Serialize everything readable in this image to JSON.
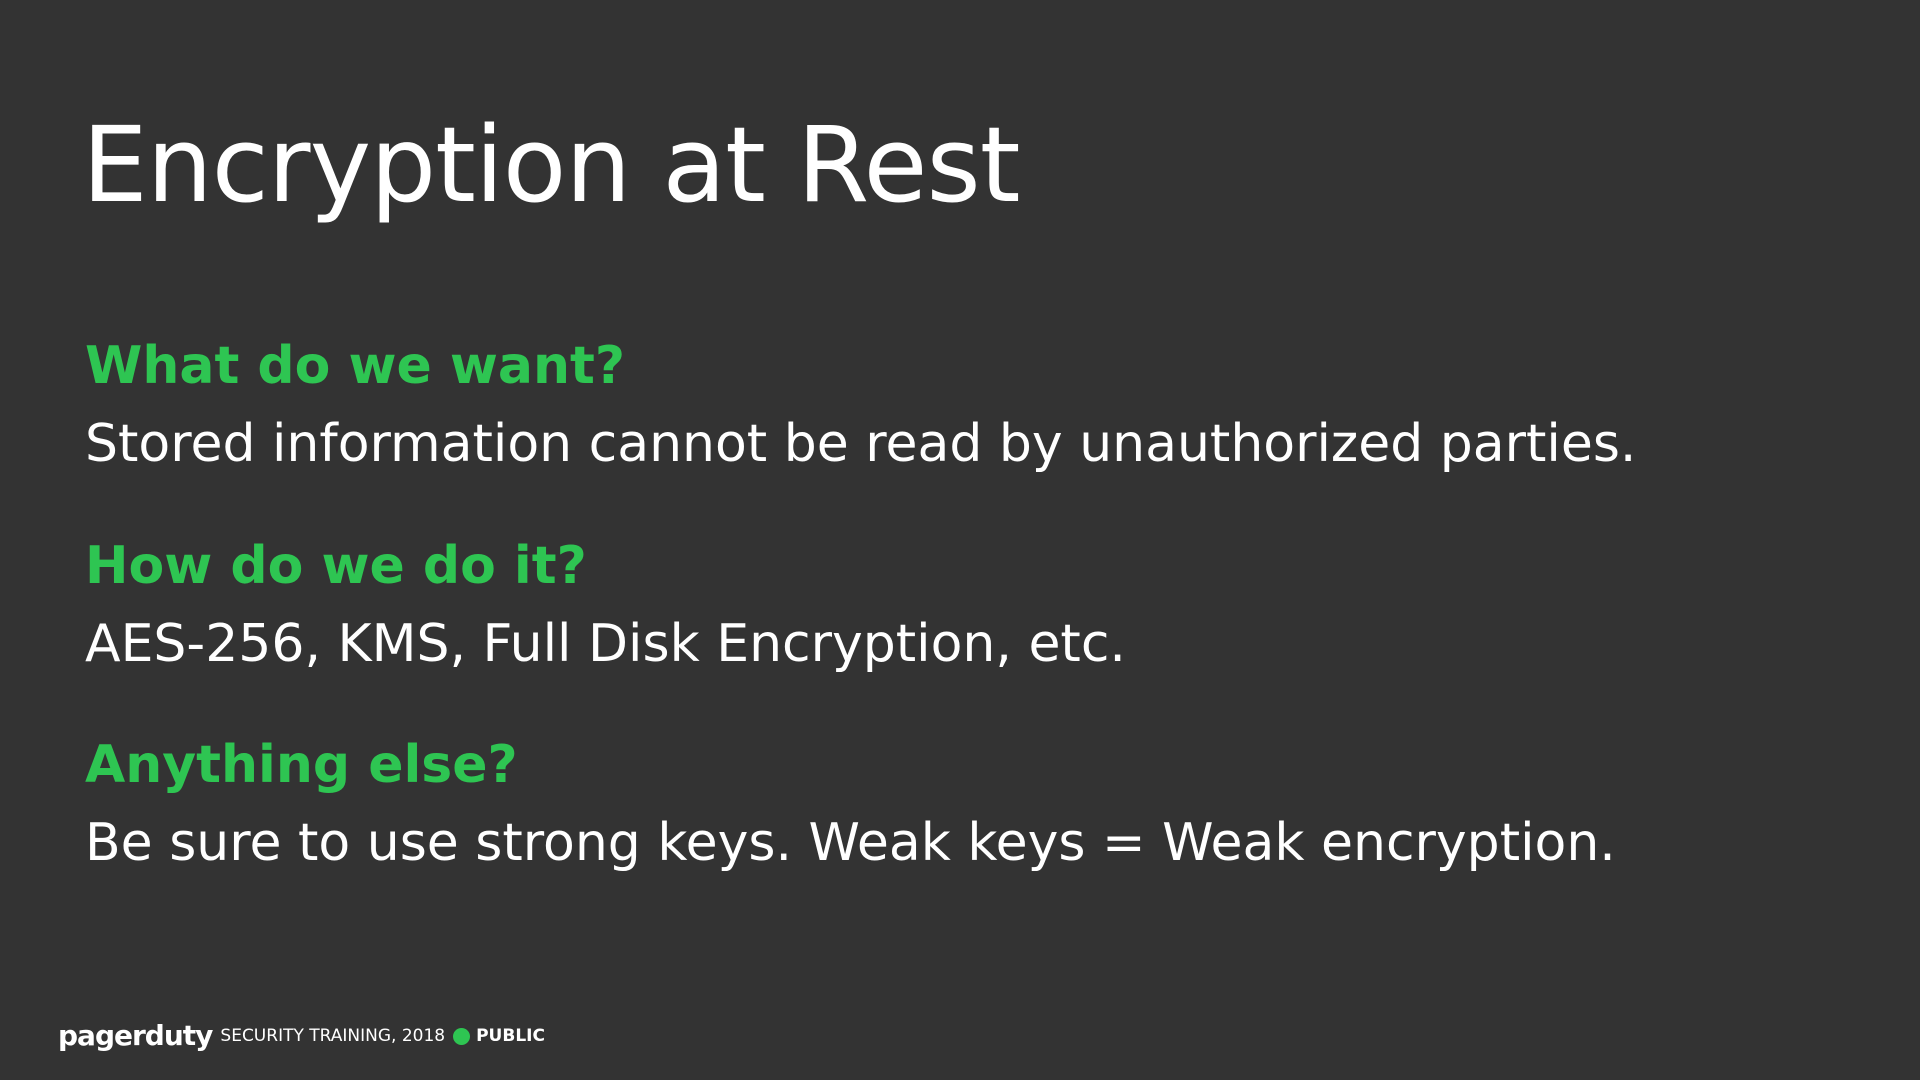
{
  "title": "Encryption at Rest",
  "sections": [
    {
      "question": "What do we want?",
      "answer": "Stored information cannot be read by unauthorized parties."
    },
    {
      "question": "How do we do it?",
      "answer": "AES-256, KMS, Full Disk Encryption, etc."
    },
    {
      "question": "Anything else?",
      "answer": "Be sure to use strong keys. Weak keys = Weak encryption."
    }
  ],
  "footer": {
    "logo": "pagerduty",
    "text": "SECURITY TRAINING, 2018",
    "classification": "PUBLIC"
  },
  "colors": {
    "background": "#333333",
    "accent": "#2ec552",
    "text": "#ffffff"
  }
}
